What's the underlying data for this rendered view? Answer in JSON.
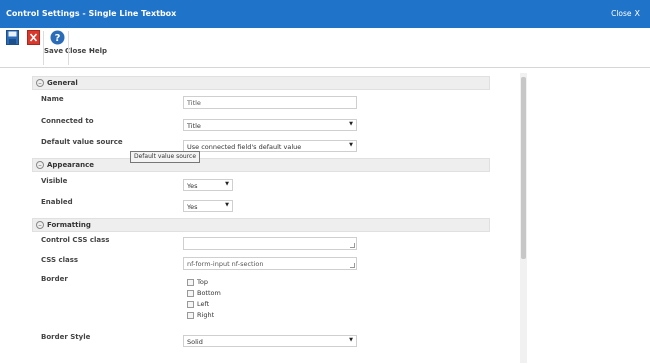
{
  "window": {
    "title": "Control Settings - Single Line Textbox",
    "close_label": "Close",
    "close_glyph": "X",
    "header_color": "#1f73c9"
  },
  "ribbon": {
    "save_label": "Save",
    "close_label": "Close",
    "help_label": "Help",
    "icons": [
      "save-icon",
      "close-icon",
      "help-icon"
    ]
  },
  "sections": {
    "general": {
      "title": "General",
      "toggle": "–",
      "name_label": "Name",
      "name_value": "Title",
      "connected_label": "Connected to",
      "connected_value": "Title",
      "default_source_label": "Default value source",
      "default_source_value": "Use connected field's default value"
    },
    "appearance": {
      "title": "Appearance",
      "toggle": "–",
      "visible_label": "Visible",
      "visible_value": "Yes",
      "enabled_label": "Enabled",
      "enabled_value": "Yes"
    },
    "formatting": {
      "title": "Formatting",
      "toggle": "–",
      "control_css_label": "Control CSS class",
      "control_css_value": "",
      "css_class_label": "CSS class",
      "css_class_value": "nf-form-input nf-section",
      "border_label": "Border",
      "border_options": [
        "Top",
        "Bottom",
        "Left",
        "Right"
      ],
      "border_style_label": "Border Style",
      "border_style_value": "Solid"
    }
  },
  "tooltip": {
    "text": "Default value source"
  },
  "caret_glyph": "▼"
}
